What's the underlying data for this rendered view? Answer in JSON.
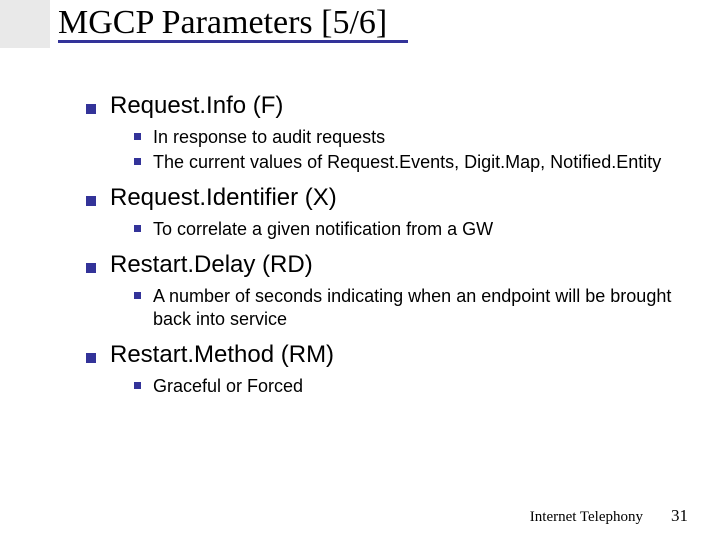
{
  "title": "MGCP Parameters [5/6]",
  "items": [
    {
      "label": "Request.Info (F)",
      "subs": [
        {
          "text": "In response to audit requests"
        },
        {
          "text": "The current values of Request.Events, Digit.Map, Notified.Entity"
        }
      ]
    },
    {
      "label": "Request.Identifier (X)",
      "subs": [
        {
          "text": "To correlate a given notification from a GW"
        }
      ]
    },
    {
      "label": "Restart.Delay (RD)",
      "subs": [
        {
          "text": "A number of seconds indicating when an endpoint will be brought back into service"
        }
      ]
    },
    {
      "label": "Restart.Method (RM)",
      "subs": [
        {
          "text": "Graceful or Forced"
        }
      ]
    }
  ],
  "footer": {
    "label": "Internet Telephony",
    "page": "31"
  }
}
